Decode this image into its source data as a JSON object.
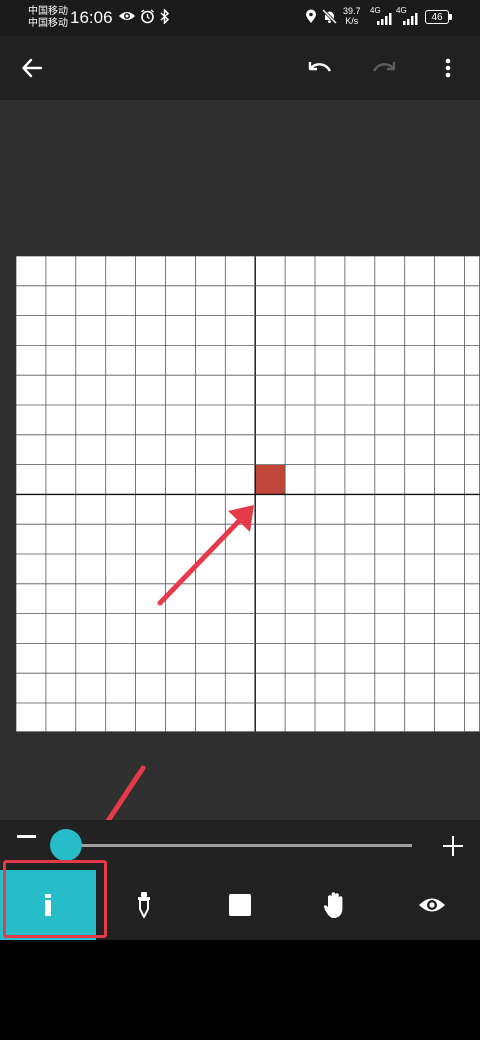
{
  "status_bar": {
    "carrier_1": "中国移动",
    "carrier_2": "中国移动",
    "time": "16:06",
    "net_speed_value": "39.7",
    "net_speed_unit": "K/s",
    "signal_1_label": "4G",
    "signal_2_label": "4G",
    "battery": "46",
    "icons": [
      "eye-icon",
      "alarm-icon",
      "bluetooth-icon",
      "location-icon",
      "mute-icon"
    ]
  },
  "toolbar": {
    "icons": [
      "back-arrow-icon",
      "undo-icon",
      "redo-icon",
      "more-vert-icon"
    ],
    "redo_enabled": false
  },
  "canvas": {
    "grid_columns": 16,
    "grid_rows": 16,
    "filled_cells": [
      {
        "col": 8,
        "row": 7,
        "color": "#c0463a"
      }
    ],
    "grid_line_color": "#555555",
    "axis_line_color": "#111111",
    "background": "#ffffff"
  },
  "brush_size": {
    "minus_label": "−",
    "plus_label": "+",
    "value_fraction": 0.0
  },
  "tools": [
    {
      "name": "pencil",
      "icon": "pencil-icon",
      "active": true
    },
    {
      "name": "eyedropper",
      "icon": "eyedropper-icon",
      "active": false
    },
    {
      "name": "eraser",
      "icon": "square-icon",
      "active": false
    },
    {
      "name": "pan",
      "icon": "hand-icon",
      "active": false
    },
    {
      "name": "preview",
      "icon": "eye-icon",
      "active": false
    }
  ],
  "colors": {
    "accent": "#26bcc8",
    "annotation": "#e53a4a",
    "toolbar_bg": "#212121",
    "canvas_bg": "#303030"
  }
}
